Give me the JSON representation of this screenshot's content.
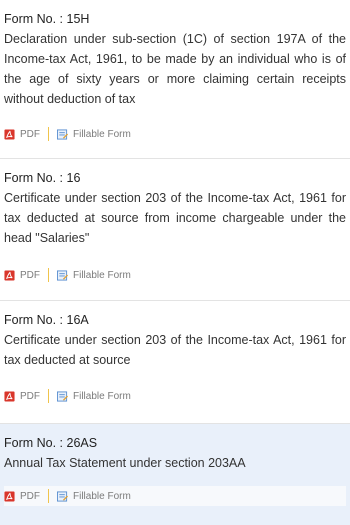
{
  "forms": [
    {
      "form_no": "Form No. : 15H",
      "description": "Declaration under sub-section (1C) of section 197A of the Income-tax Act, 1961, to be made by an individual who is of the age of sixty years or more claiming certain receipts without deduction of tax",
      "pdf_label": "PDF",
      "fillable_label": "Fillable Form"
    },
    {
      "form_no": "Form No. : 16",
      "description": "Certificate under section 203 of the Income-tax Act, 1961 for tax deducted at source from income chargeable under the head \"Salaries\"",
      "pdf_label": "PDF",
      "fillable_label": "Fillable Form"
    },
    {
      "form_no": "Form No. : 16A",
      "description": "Certificate under section 203 of the Income-tax Act, 1961 for tax deducted at source",
      "pdf_label": "PDF",
      "fillable_label": "Fillable Form"
    },
    {
      "form_no": "Form No. : 26AS",
      "description": "Annual Tax Statement under section 203AA",
      "pdf_label": "PDF",
      "fillable_label": "Fillable Form"
    }
  ],
  "colors": {
    "highlight_row": "#e9f0fa",
    "pdf_icon": "#d9362b",
    "separator": "#f0c44c",
    "form_icon": "#5a8fd0"
  },
  "icons": {
    "pdf": "pdf-icon",
    "fillable": "fillable-form-icon"
  }
}
